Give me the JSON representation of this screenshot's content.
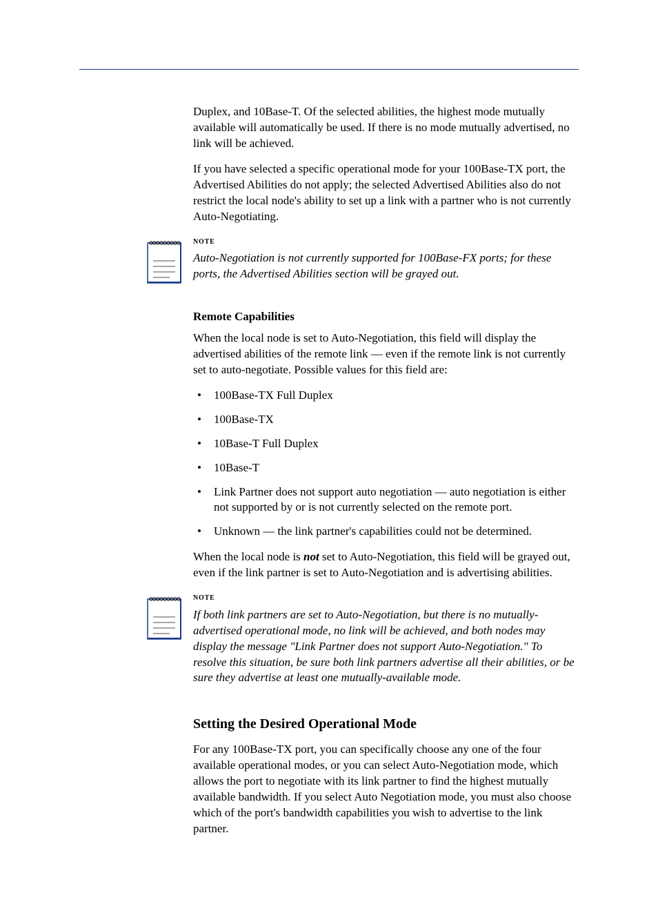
{
  "header": {
    "chapter_title": ""
  },
  "para1": "Duplex, and 10Base-T. Of the selected abilities, the highest mode mutually available will automatically be used. If there is no mode mutually advertised, no link will be achieved.",
  "para2": "If you have selected a specific operational mode for your 100Base-TX port, the Advertised Abilities do not apply; the selected Advertised Abilities also do not restrict the local node's ability to set up a link with a partner who is not currently Auto-Negotiating.",
  "note1_label": "NOTE",
  "note1_text": "Auto-Negotiation is not currently supported for 100Base-FX ports; for these ports, the Advertised Abilities section will be grayed out.",
  "heading_remote": "Remote Capabilities",
  "para3": "When the local node is set to Auto-Negotiation, this field will display the advertised abilities of the remote link — even if the remote link is not currently set to auto-negotiate. Possible values for this field are:",
  "bullets": [
    "100Base-TX Full Duplex",
    "100Base-TX",
    "10Base-T Full Duplex",
    "10Base-T",
    "Link Partner does not support auto negotiation — auto negotiation is either not supported by or is not currently selected on the remote port.",
    "Unknown — the link partner's capabilities could not be determined."
  ],
  "para4_pre": "When the local node is ",
  "para4_not": "not",
  "para4_post": " set to Auto-Negotiation, this field will be grayed out, even if the link partner is set to Auto-Negotiation and is advertising abilities.",
  "note2_label": "NOTE",
  "note2_text": "If both link partners are set to Auto-Negotiation, but there is no mutually-advertised operational mode, no link will be achieved, and both nodes may display the message \"Link Partner does not support Auto-Negotiation.\" To resolve this situation, be sure both link partners advertise all their abilities, or be sure they advertise at least one mutually-available mode.",
  "heading_setting": "Setting the Desired Operational Mode",
  "para5": "For any 100Base-TX port, you can specifically choose any one of the four available operational modes, or you can select Auto-Negotiation mode, which allows the port to negotiate with its link partner to find the highest mutually available bandwidth. If you select Auto Negotiation mode, you must also choose which of the port's bandwidth capabilities you wish to advertise to the link partner.",
  "footer": {
    "label": "",
    "page": ""
  }
}
